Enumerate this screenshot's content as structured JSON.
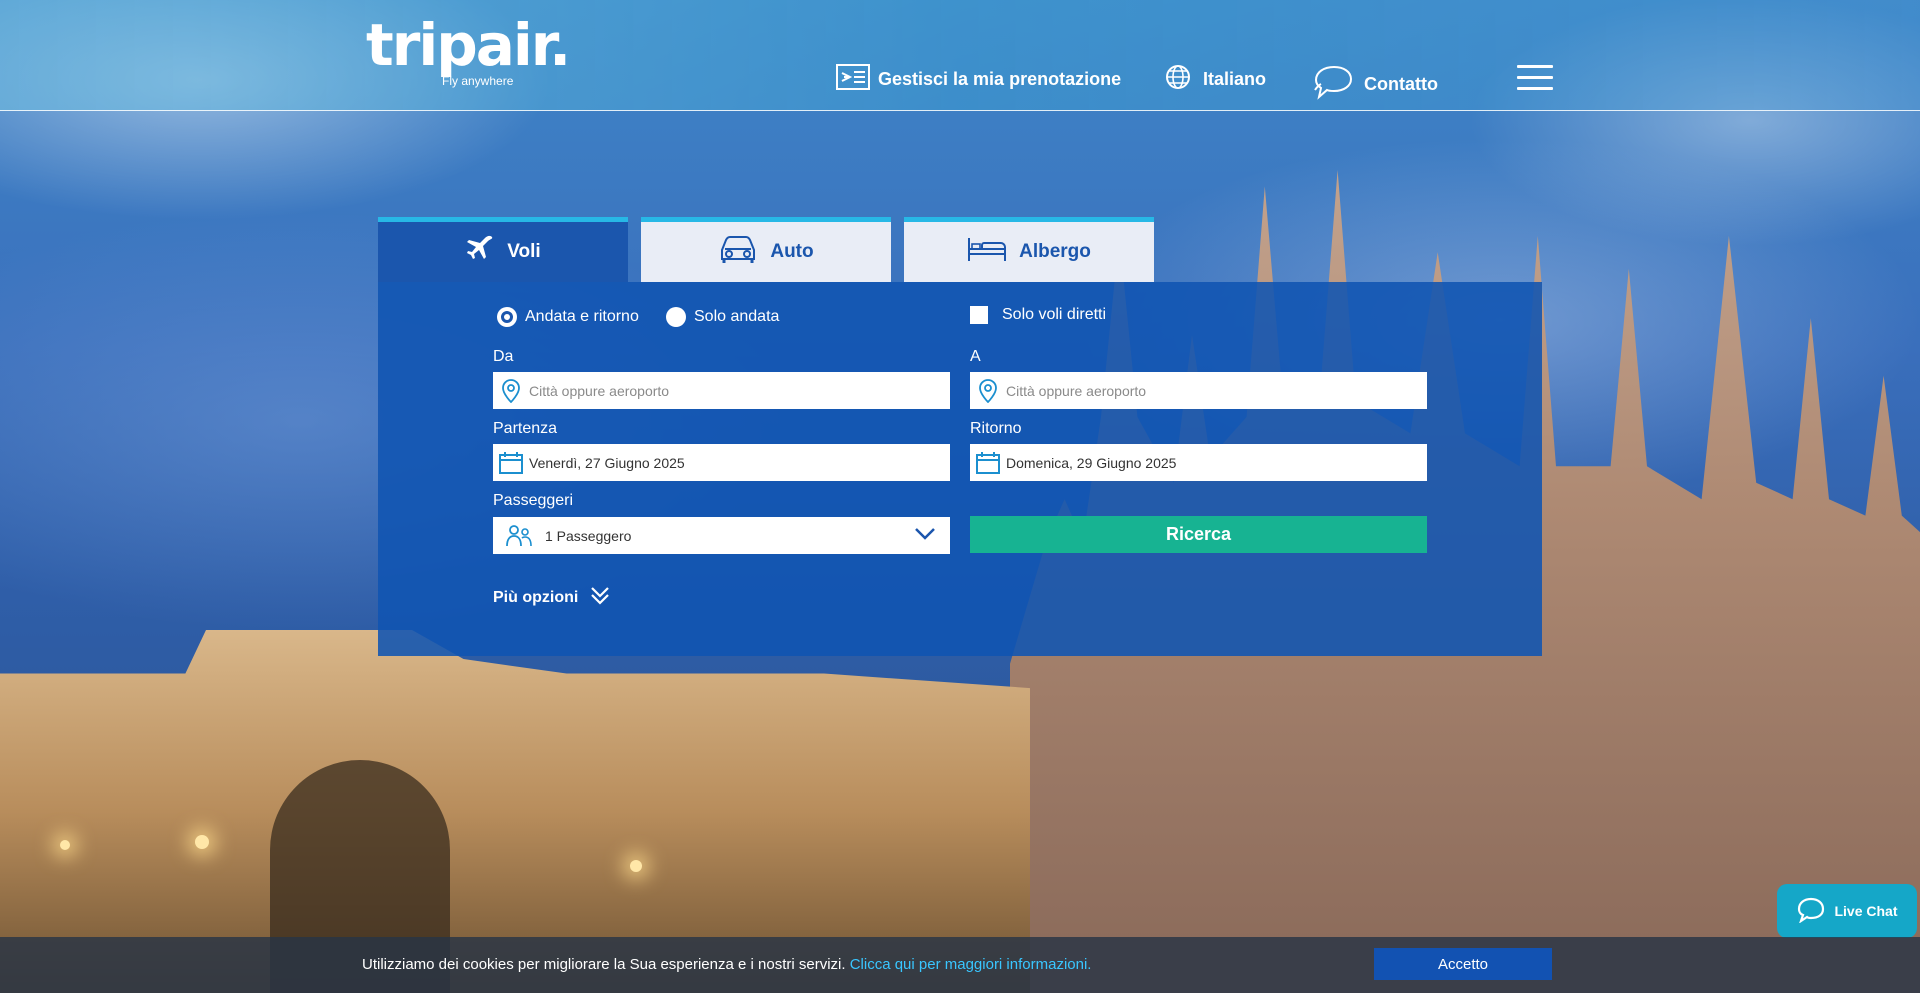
{
  "brand": {
    "name": "tripair.",
    "tagline": "Fly anywhere"
  },
  "header": {
    "manage_booking": "Gestisci la mia prenotazione",
    "language": "Italiano",
    "contact": "Contatto"
  },
  "tabs": [
    {
      "label": "Voli",
      "icon": "plane-icon",
      "active": true
    },
    {
      "label": "Auto",
      "icon": "car-icon",
      "active": false
    },
    {
      "label": "Albergo",
      "icon": "bed-icon",
      "active": false
    }
  ],
  "search": {
    "trip_type": {
      "round_trip": "Andata e ritorno",
      "one_way": "Solo andata",
      "selected": "Andata e ritorno"
    },
    "direct_only": {
      "label": "Solo voli diretti",
      "checked": false
    },
    "from": {
      "label": "Da",
      "placeholder": "Città oppure aeroporto",
      "value": ""
    },
    "to": {
      "label": "A",
      "placeholder": "Città oppure aeroporto",
      "value": ""
    },
    "departure": {
      "label": "Partenza",
      "value": "Venerdì, 27 Giugno 2025"
    },
    "return": {
      "label": "Ritorno",
      "value": "Domenica, 29 Giugno 2025"
    },
    "passengers": {
      "label": "Passeggeri",
      "value": "1 Passeggero"
    },
    "submit": "Ricerca",
    "more_options": "Più opzioni"
  },
  "cookie": {
    "text": "Utilizziamo dei cookies per migliorare la Sua esperienza e i nostri servizi. ",
    "link": "Clicca qui per maggiori informazioni.",
    "accept": "Accetto"
  },
  "live_chat": "Live Chat",
  "colors": {
    "primary": "#1b56ad",
    "accent_tab": "#27b8e6",
    "search_button": "#17b392",
    "cookie_link": "#39c6ff"
  }
}
